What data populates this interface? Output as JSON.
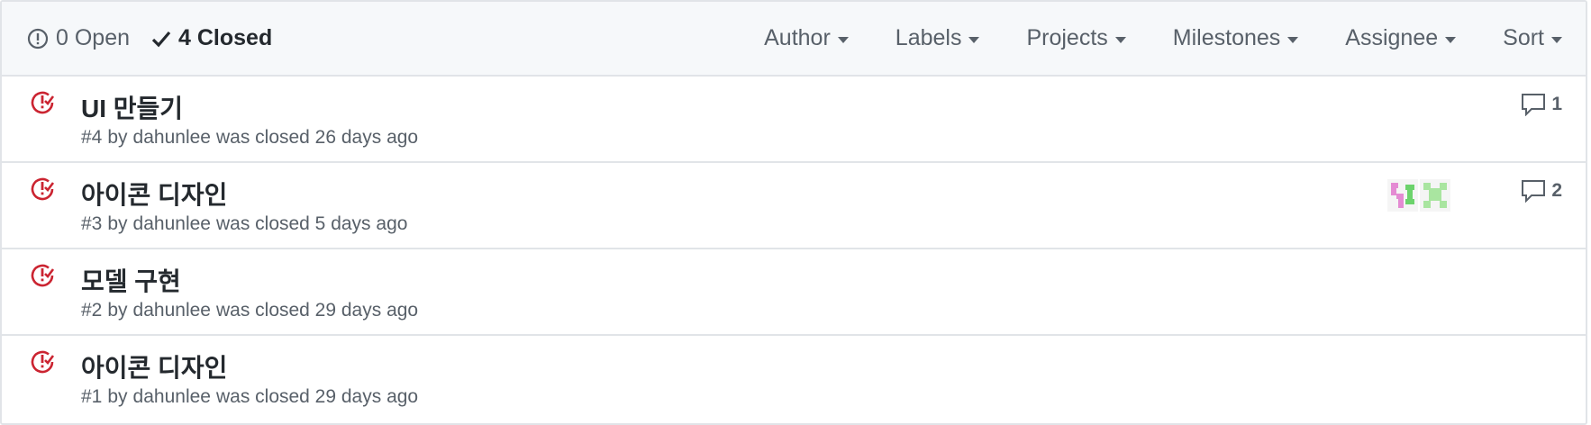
{
  "header": {
    "open_count_label": "0 Open",
    "closed_count_label": "4 Closed",
    "filters": [
      "Author",
      "Labels",
      "Projects",
      "Milestones",
      "Assignee",
      "Sort"
    ]
  },
  "issues": [
    {
      "title": "UI 만들기",
      "number": "#4",
      "by": "by",
      "author": "dahunlee",
      "closed_text": "was closed 26 days ago",
      "comments": "1"
    },
    {
      "title": "아이콘 디자인",
      "number": "#3",
      "by": "by",
      "author": "dahunlee",
      "closed_text": "was closed 5 days ago",
      "comments": "2"
    },
    {
      "title": "모델 구현",
      "number": "#2",
      "by": "by",
      "author": "dahunlee",
      "closed_text": "was closed 29 days ago"
    },
    {
      "title": "아이콘 디자인",
      "number": "#1",
      "by": "by",
      "author": "dahunlee",
      "closed_text": "was closed 29 days ago"
    }
  ],
  "colors": {
    "closed_icon": "#cb2431",
    "muted_text": "#586069",
    "header_bg": "#f6f8fa",
    "border": "#e1e4e8"
  }
}
